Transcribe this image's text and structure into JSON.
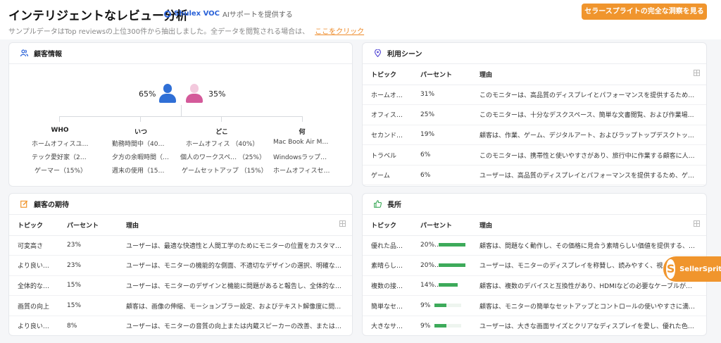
{
  "header": {
    "title": "インテリジェントなレビュー分析",
    "brand_name": "Shulex VOC",
    "brand_tagline": "AIサポートを提供する",
    "subtitle": "サンプルデータはTop reviewsの上位300件から抽出しました。全データを閲覧される場合は、",
    "subtitle_link": "ここをクリック",
    "cta_label": "セラースプライトの完全な洞察を見る"
  },
  "customer_info": {
    "title": "顧客情報",
    "icon": "users-icon",
    "male_pct": "65%",
    "female_pct": "35%",
    "columns": [
      {
        "header": "WHO",
        "items": [
          "ホームオフィスユ…",
          "テック愛好家（2…",
          "ゲーマー（15%）"
        ]
      },
      {
        "header": "いつ",
        "items": [
          "勤務時間中（40…",
          "夕方の余暇時間（…",
          "週末の使用（15…"
        ]
      },
      {
        "header": "どこ",
        "items": [
          "ホームオフィス （40%）",
          "個人のワークスペ… （25%）",
          "ゲームセットアップ （15%）"
        ]
      },
      {
        "header": "何",
        "items": [
          "Mac Book Air M…",
          "Windowsラップ…",
          "ホームオフィスセ…"
        ]
      }
    ]
  },
  "usage_scenes": {
    "title": "利用シーン",
    "icon": "location-pin-icon",
    "headers": {
      "topic": "トピック",
      "percent": "パーセント",
      "reason": "理由"
    },
    "rows": [
      {
        "topic": "ホームオ…",
        "percent": "31%",
        "reason": "このモニターは、高品質のディスプレイとパフォーマンスを提供するため…"
      },
      {
        "topic": "オフィス…",
        "percent": "25%",
        "reason": "このモニターは、十分なデスクスペース、簡単な文書閲覧、および作業場…"
      },
      {
        "topic": "セカンド…",
        "percent": "19%",
        "reason": "顧客は、作業、ゲーム、デジタルアート、およびラップトップデスクトップ…"
      },
      {
        "topic": "トラベル",
        "percent": "6%",
        "reason": "このモニターは、携帯性と使いやすさがあり、旅行中に作業する顧客に人…"
      },
      {
        "topic": "ゲーム",
        "percent": "6%",
        "reason": "ユーザーは、高品質のディスプレイとパフォーマンスを提供するため、ゲ…"
      }
    ]
  },
  "expectations": {
    "title": "顧客の期待",
    "icon": "edit-icon",
    "headers": {
      "topic": "トピック",
      "percent": "パーセント",
      "reason": "理由"
    },
    "rows": [
      {
        "topic": "可変高さ",
        "percent": "23%",
        "reason": "ユーザーは、最適な快適性と人間工学のためにモニターの位置をカスタマ…"
      },
      {
        "topic": "より良い…",
        "percent": "23%",
        "reason": "ユーザーは、モニターの機能的な側面、不適切なデザインの選択、明確な…"
      },
      {
        "topic": "全体的な…",
        "percent": "15%",
        "reason": "ユーザーは、モニターのデザインと機能に問題があると報告し、全体的な…"
      },
      {
        "topic": "画質の向上",
        "percent": "15%",
        "reason": "顧客は、画像の伸縮、モーションブラー設定、およびテキスト解像度に問…"
      },
      {
        "topic": "より良い…",
        "percent": "8%",
        "reason": "ユーザーは、モニターの音質の向上または内蔵スピーカーの改善、または…"
      }
    ]
  },
  "strengths": {
    "title": "長所",
    "icon": "thumbs-up-icon",
    "headers": {
      "topic": "トピック",
      "percent": "パーセント",
      "reason": "理由"
    },
    "rows": [
      {
        "topic": "優れた品…",
        "percent": "20%",
        "value": 0.2,
        "reason": "顧客は、問題なく動作し、その価格に見合う素晴らしい価値を提供する、…"
      },
      {
        "topic": "素晴らし…",
        "percent": "20%",
        "value": 0.2,
        "reason": "ユーザーは、モニターのディスプレイを称賛し、読みやすく、視…"
      },
      {
        "topic": "複数の接…",
        "percent": "14%",
        "value": 0.14,
        "reason": "顧客は、複数のデバイスと互換性があり、HDMIなどの必要なケーブルが含…"
      },
      {
        "topic": "簡単なセ…",
        "percent": "9%",
        "value": 0.09,
        "reason": "顧客は、モニターの簡単なセットアップとコントロールの使いやすさに満…"
      },
      {
        "topic": "大きなサ…",
        "percent": "9%",
        "value": 0.09,
        "reason": "ユーザーは、大きな画面サイズとクリアなディスプレイを愛し、優れた色…"
      }
    ]
  },
  "floating_badge": {
    "label": "SellerSprite",
    "logo": "S"
  },
  "colors": {
    "accent": "#f0952d",
    "brand": "#2a62d8",
    "male": "#2f6fd6",
    "female": "#d45a9a",
    "bar": "#3daa5a"
  }
}
